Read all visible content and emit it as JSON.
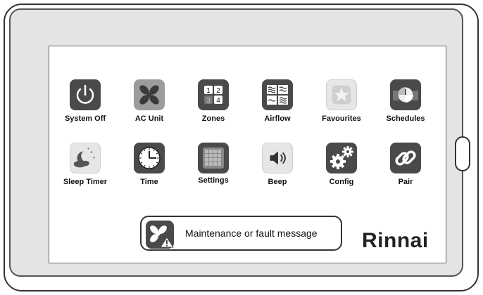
{
  "tiles": [
    {
      "label": "System Off",
      "icon": "power-icon"
    },
    {
      "label": "AC Unit",
      "icon": "fan-icon"
    },
    {
      "label": "Zones",
      "icon": "zones-icon"
    },
    {
      "label": "Airflow",
      "icon": "airflow-icon"
    },
    {
      "label": "Favourites",
      "icon": "star-icon"
    },
    {
      "label": "Schedules",
      "icon": "clock-icon"
    },
    {
      "label": "Sleep Timer",
      "icon": "moon-icon"
    },
    {
      "label": "Time",
      "icon": "clock-icon"
    },
    {
      "label": "Settings",
      "icon": "grid-icon"
    },
    {
      "label": "Beep",
      "icon": "speaker-icon"
    },
    {
      "label": "Config",
      "icon": "gears-icon"
    },
    {
      "label": "Pair",
      "icon": "link-icon"
    }
  ],
  "zone_numbers": [
    "1",
    "2",
    "3",
    "4"
  ],
  "fault": {
    "message": "Maintenance or fault message",
    "icon": "fan-warning-icon"
  },
  "brand": "Rinnai",
  "colors": {
    "icon_dark": "#4a4a4a",
    "icon_grey": "#9c9c9c",
    "icon_light": "#e6e6e6",
    "bezel": "#e4e4e4"
  }
}
